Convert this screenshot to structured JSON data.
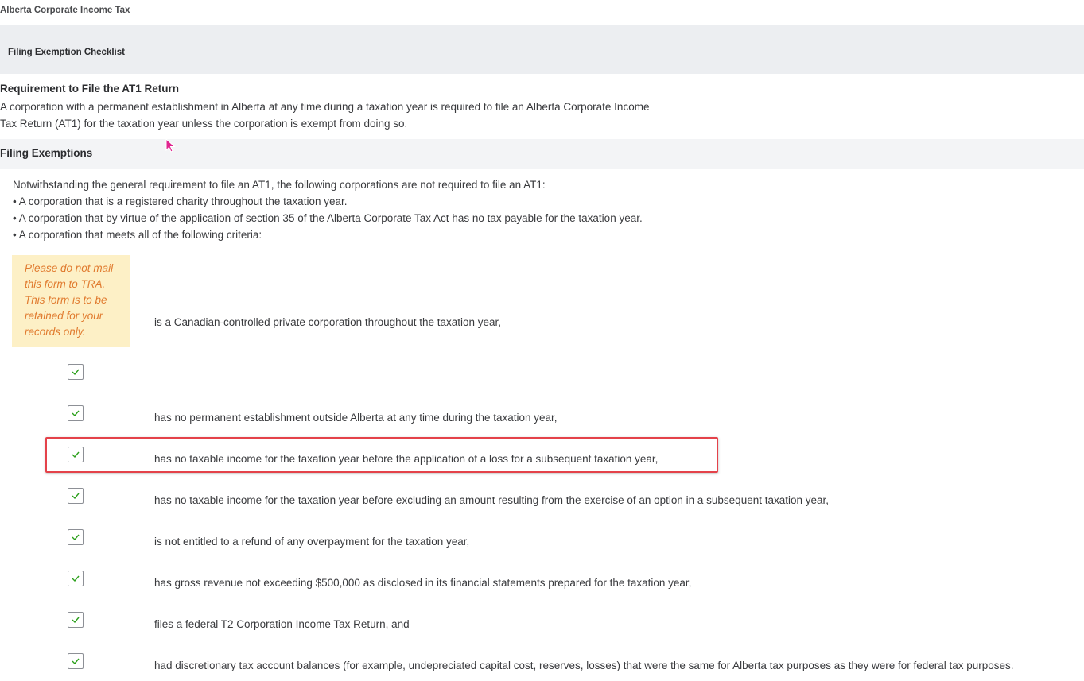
{
  "app": {
    "title": "Alberta Corporate Income Tax"
  },
  "checklist": {
    "title": "Filing Exemption Checklist"
  },
  "requirement": {
    "heading": "Requirement to File the AT1 Return",
    "line1": "A corporation with a permanent establishment in Alberta at any time during a taxation year is required to file an Alberta Corporate Income",
    "line2": "Tax Return (AT1) for the taxation year unless the corporation is exempt from doing so."
  },
  "exemptions": {
    "heading": "Filing Exemptions",
    "intro": "Notwithstanding the general requirement to file an AT1, the following corporations are not required to file an AT1:",
    "bullets": [
      "• A corporation that is a registered charity throughout the taxation year.",
      "• A corporation that by virtue of the application of section 35 of the Alberta Corporate Tax Act has no tax payable for the taxation year.",
      "• A corporation that meets all of the following criteria:"
    ]
  },
  "note": {
    "text": "Please do not mail this form to TRA. This form is to be retained for your records only."
  },
  "criteria": [
    {
      "text": "is a Canadian-controlled private corporation throughout the taxation year,"
    },
    {
      "text": ""
    },
    {
      "text": "has no permanent establishment outside Alberta at any time during the taxation year,"
    },
    {
      "text": "has no taxable income for the taxation year before the application of a loss for a subsequent taxation year,"
    },
    {
      "text": "has no taxable income for the taxation year before excluding an amount resulting from the exercise of an option in a subsequent taxation year,"
    },
    {
      "text": "is not entitled to a refund of any overpayment for the taxation year,"
    },
    {
      "text": "has gross revenue not exceeding $500,000 as disclosed in its financial statements prepared for the taxation year,"
    },
    {
      "text": "files a federal T2 Corporation Income Tax Return, and"
    },
    {
      "text": "had discretionary tax account balances (for example, undepreciated capital cost, reserves, losses) that were the same for Alberta tax purposes as they were for federal tax purposes."
    }
  ],
  "checkboxes": [
    {
      "checked": true
    },
    {
      "checked": true
    },
    {
      "checked": true
    },
    {
      "checked": true
    },
    {
      "checked": true
    },
    {
      "checked": true
    },
    {
      "checked": true
    },
    {
      "checked": true
    }
  ],
  "colors": {
    "check": "#2ca01c",
    "highlight": "#e4424a",
    "note_bg": "#fdf0c6",
    "note_text": "#e07a2e"
  }
}
